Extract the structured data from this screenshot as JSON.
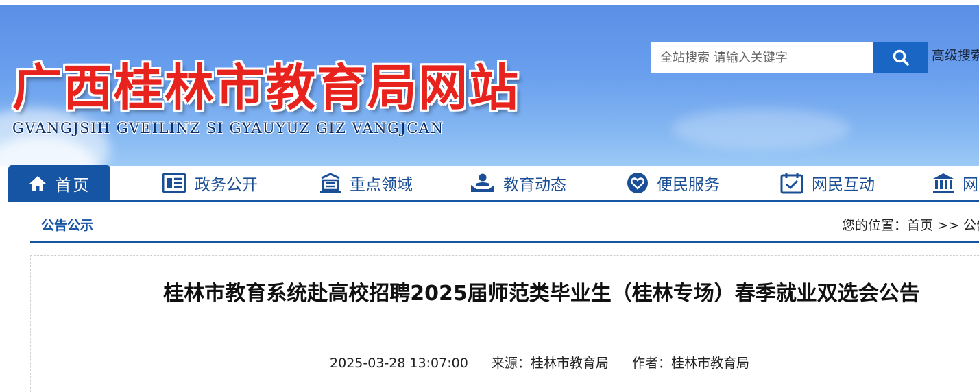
{
  "header": {
    "site_title": "广西桂林市教育局网站",
    "site_subtitle": "GVANGJSIH GVEILINZ SI GYAUYUZ GIZ VANGJCAN",
    "search_placeholder": "全站搜索 请输入关键字",
    "advanced_search_label": "高级搜索"
  },
  "nav": {
    "home_label": "首页",
    "items": [
      {
        "label": "政务公开",
        "icon": "document-icon"
      },
      {
        "label": "重点领域",
        "icon": "building-icon"
      },
      {
        "label": "教育动态",
        "icon": "person-hands-icon"
      },
      {
        "label": "便民服务",
        "icon": "heart-icon"
      },
      {
        "label": "网民互动",
        "icon": "calendar-check-icon"
      },
      {
        "label": "网站",
        "icon": "bank-icon"
      }
    ]
  },
  "breadcrumb": {
    "section_title": "公告公示",
    "location_label": "您的位置：",
    "home_link": "首页",
    "separator": ">>",
    "current": "公告公示"
  },
  "article": {
    "title": "桂林市教育系统赴高校招聘2025届师范类毕业生（桂林专场）春季就业双选会公告",
    "date": "2025-03-28 13:07:00",
    "source_label": "来源：",
    "source": "桂林市教育局",
    "author_label": "作者：",
    "author": "桂林市教育局"
  },
  "colors": {
    "primary_blue": "#1655a4",
    "title_red": "#e8231e",
    "header_gradient_top": "#5b8fe6",
    "header_gradient_bottom": "#9ccaf6"
  }
}
